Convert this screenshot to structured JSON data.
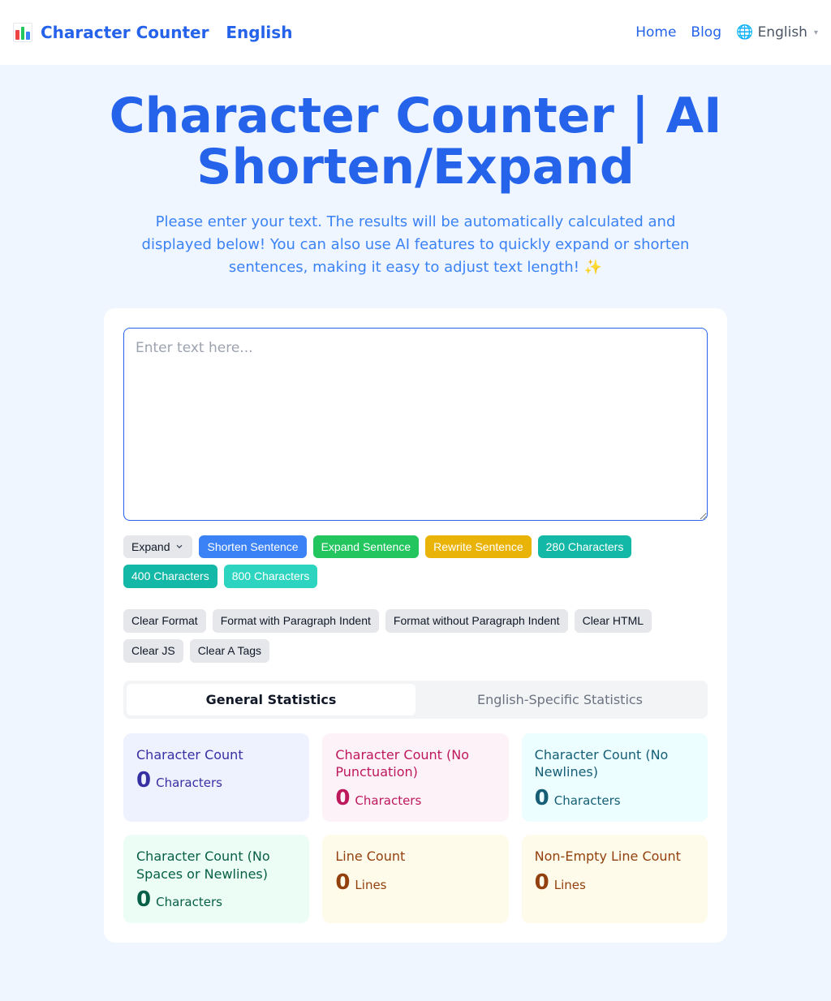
{
  "header": {
    "brand": "Character Counter",
    "brand_lang": "English",
    "nav_home": "Home",
    "nav_blog": "Blog",
    "lang_label": "🌐 English"
  },
  "hero": {
    "title": "Character Counter | AI Shorten/Expand",
    "subtitle": "Please enter your text. The results will be automatically calculated and displayed below! You can also use AI features to quickly expand or shorten sentences, making it easy to adjust text length! ✨"
  },
  "input": {
    "placeholder": "Enter text here...",
    "value": ""
  },
  "ai_buttons": {
    "expand_dropdown": "Expand",
    "shorten": "Shorten Sentence",
    "expand": "Expand Sentence",
    "rewrite": "Rewrite Sentence",
    "c280": "280 Characters",
    "c400": "400 Characters",
    "c800": "800 Characters"
  },
  "format_buttons": {
    "clear_format": "Clear Format",
    "fmt_with_indent": "Format with Paragraph Indent",
    "fmt_without_indent": "Format without Paragraph Indent",
    "clear_html": "Clear HTML",
    "clear_js": "Clear JS",
    "clear_a": "Clear A Tags"
  },
  "tabs": {
    "general": "General Statistics",
    "english": "English-Specific Statistics"
  },
  "stats": {
    "char_count": {
      "label": "Character Count",
      "value": "0",
      "unit": "Characters"
    },
    "char_no_punct": {
      "label": "Character Count (No Punctuation)",
      "value": "0",
      "unit": "Characters"
    },
    "char_no_newline": {
      "label": "Character Count (No Newlines)",
      "value": "0",
      "unit": "Characters"
    },
    "char_no_space_newline": {
      "label": "Character Count (No Spaces or Newlines)",
      "value": "0",
      "unit": "Characters"
    },
    "line_count": {
      "label": "Line Count",
      "value": "0",
      "unit": "Lines"
    },
    "nonempty_line_count": {
      "label": "Non-Empty Line Count",
      "value": "0",
      "unit": "Lines"
    }
  }
}
